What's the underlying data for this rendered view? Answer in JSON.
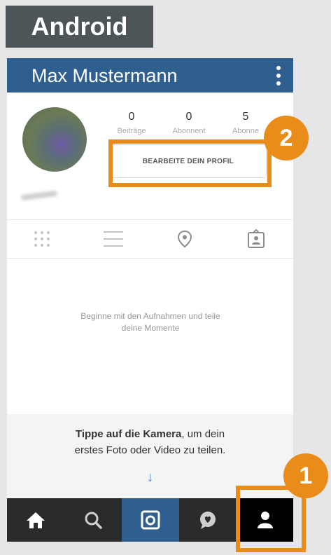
{
  "platform_label": "Android",
  "app_bar": {
    "title": "Max Mustermann"
  },
  "profile": {
    "stats": [
      {
        "value": "0",
        "label": "Beiträge"
      },
      {
        "value": "0",
        "label": "Abonnent"
      },
      {
        "value": "5",
        "label": "Abonne"
      }
    ],
    "edit_button": "BEARBEITE DEIN PROFIL"
  },
  "tabs": [
    "grid-view",
    "list-view",
    "map-view",
    "tagged-view"
  ],
  "empty_state": {
    "line1": "Beginne mit den Aufnahmen und teile",
    "line2": "deine Momente"
  },
  "hint": {
    "bold": "Tippe auf die Kamera",
    "rest": ", um dein",
    "line2": "erstes Foto oder Video zu teilen.",
    "arrow": "↓"
  },
  "bottom_nav": [
    "home",
    "search",
    "camera",
    "activity",
    "profile"
  ],
  "callouts": {
    "edit_profile_step": "2",
    "profile_tab_step": "1"
  },
  "colors": {
    "app_bar": "#2e5f8f",
    "accent": "#e98c1a",
    "nav_bar": "#2b2b2b",
    "camera_active": "#2e5f8f"
  }
}
